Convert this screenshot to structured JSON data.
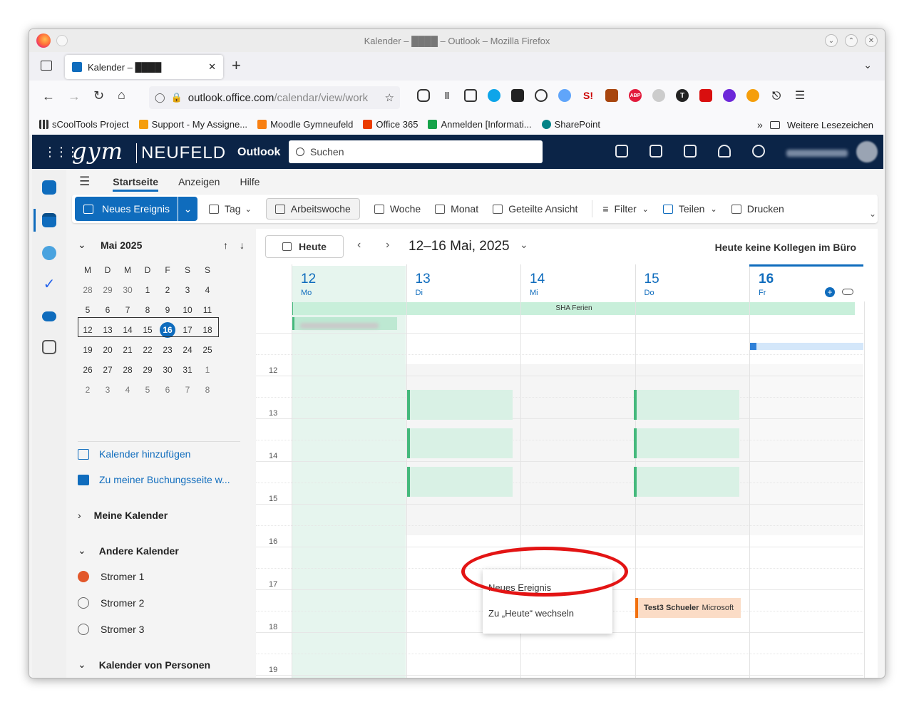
{
  "window": {
    "title": "Kalender – ████ – Outlook – Mozilla Firefox"
  },
  "tab": {
    "label": "Kalender – ████"
  },
  "urlbar": {
    "host": "outlook.office.com",
    "path": "/calendar/view/work"
  },
  "bookmarks": [
    {
      "label": "sCoolTools Project"
    },
    {
      "label": "Support - My Assigne..."
    },
    {
      "label": "Moodle Gymneufeld"
    },
    {
      "label": "Office 365"
    },
    {
      "label": "Anmelden [Informati..."
    },
    {
      "label": "SharePoint"
    }
  ],
  "bookmarks_more": "Weitere Lesezeichen",
  "brand": {
    "gym": "gym",
    "neufeld": "NEUFELD",
    "app": "Outlook"
  },
  "search": {
    "placeholder": "Suchen"
  },
  "ribbon_tabs": [
    "Startseite",
    "Anzeigen",
    "Hilfe"
  ],
  "ribbon": {
    "new_event": "Neues Ereignis",
    "day": "Tag",
    "work_week": "Arbeitswoche",
    "week": "Woche",
    "month": "Monat",
    "shared": "Geteilte Ansicht",
    "filter": "Filter",
    "share": "Teilen",
    "print": "Drucken"
  },
  "mini_calendar": {
    "month": "Mai 2025",
    "weekdays": [
      "M",
      "D",
      "M",
      "D",
      "F",
      "S",
      "S"
    ],
    "weeks": [
      [
        "28",
        "29",
        "30",
        "1",
        "2",
        "3",
        "4"
      ],
      [
        "5",
        "6",
        "7",
        "8",
        "9",
        "10",
        "11"
      ],
      [
        "12",
        "13",
        "14",
        "15",
        "16",
        "17",
        "18"
      ],
      [
        "19",
        "20",
        "21",
        "22",
        "23",
        "24",
        "25"
      ],
      [
        "26",
        "27",
        "28",
        "29",
        "30",
        "31",
        "1"
      ],
      [
        "2",
        "3",
        "4",
        "5",
        "6",
        "7",
        "8"
      ]
    ],
    "today": "16"
  },
  "left_links": {
    "add_calendar": "Kalender hinzufügen",
    "booking": "Zu meiner Buchungsseite w..."
  },
  "sections": {
    "my_calendars": "Meine Kalender",
    "other_calendars": "Andere Kalender",
    "people_calendars": "Kalender von Personen"
  },
  "other_calendar_items": [
    "Stromer 1",
    "Stromer 2",
    "Stromer 3"
  ],
  "main": {
    "today_button": "Heute",
    "range": "12–16 Mai, 2025",
    "no_office": "Heute keine Kollegen im Büro"
  },
  "days": [
    {
      "num": "12",
      "name": "Mo"
    },
    {
      "num": "13",
      "name": "Di"
    },
    {
      "num": "14",
      "name": "Mi"
    },
    {
      "num": "15",
      "name": "Do"
    },
    {
      "num": "16",
      "name": "Fr"
    }
  ],
  "allday_event": "SHA Ferien",
  "hours": [
    "12",
    "13",
    "14",
    "15",
    "16",
    "17",
    "18",
    "19"
  ],
  "context_menu": {
    "new_event": "Neues Ereignis",
    "go_today": "Zu „Heute“ wechseln"
  },
  "event_test3": {
    "title": "Test3 Schueler",
    "org": "Microsoft"
  },
  "colors": {
    "accent": "#0f6cbd",
    "header": "#0b2447",
    "event_green": "#d9f1e5",
    "event_orange": "#fbdcc6",
    "annotation": "#e31414"
  }
}
